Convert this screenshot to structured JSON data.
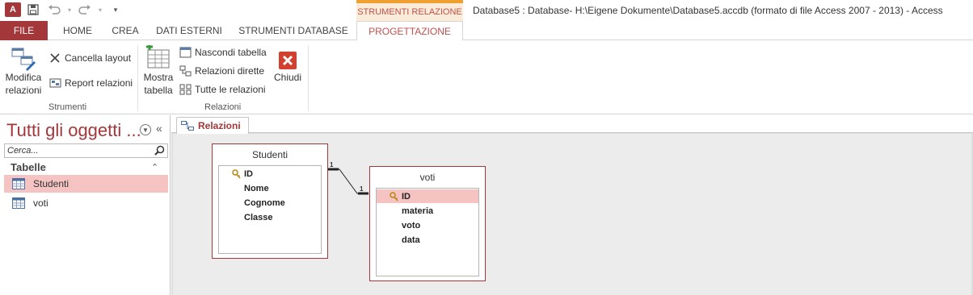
{
  "title_bar": {
    "app_badge": "A",
    "window_title": "Database5 : Database- H:\\Eigene Dokumente\\Database5.accdb (formato di file Access 2007 - 2013) - Access",
    "context_tab_group": "STRUMENTI RELAZIONE",
    "qat": {
      "save": "save-icon",
      "undo": "undo-icon",
      "redo": "redo-icon",
      "customize": "customize-icon"
    }
  },
  "ribbon_tabs": [
    "FILE",
    "HOME",
    "CREA",
    "DATI ESTERNI",
    "STRUMENTI DATABASE",
    "PROGETTAZIONE"
  ],
  "ribbon": {
    "strumenti": {
      "label": "Strumenti",
      "modifica": [
        "Modifica",
        "relazioni"
      ],
      "cancella": "Cancella layout",
      "report": "Report relazioni"
    },
    "relazioni": {
      "label": "Relazioni",
      "mostra": [
        "Mostra",
        "tabella"
      ],
      "nascondi": "Nascondi tabella",
      "dirette": "Relazioni dirette",
      "tutte": "Tutte le relazioni",
      "chiudi": "Chiudi"
    }
  },
  "nav_pane": {
    "title": "Tutti gli oggetti ...",
    "search_placeholder": "Cerca...",
    "section": "Tabelle",
    "items": [
      {
        "label": "Studenti",
        "selected": true
      },
      {
        "label": "voti",
        "selected": false
      }
    ]
  },
  "document": {
    "tab_label": "Relazioni",
    "tables": [
      {
        "name": "Studenti",
        "fields": [
          "ID",
          "Nome",
          "Cognome",
          "Classe"
        ],
        "primary_key": "ID"
      },
      {
        "name": "voti",
        "fields": [
          "ID",
          "materia",
          "voto",
          "data"
        ],
        "primary_key": "ID",
        "selected_field": "ID"
      }
    ],
    "relationship": {
      "left_label": "1",
      "right_label": "1"
    }
  },
  "colors": {
    "accent": "#a4373a",
    "selection": "#f6c3c3",
    "context_tab": "#f0a030"
  }
}
